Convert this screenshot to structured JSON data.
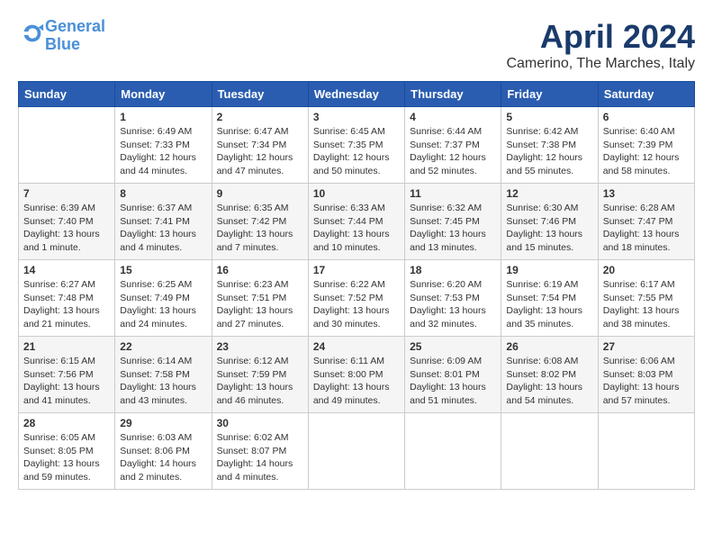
{
  "header": {
    "logo_line1": "General",
    "logo_line2": "Blue",
    "month": "April 2024",
    "location": "Camerino, The Marches, Italy"
  },
  "days_of_week": [
    "Sunday",
    "Monday",
    "Tuesday",
    "Wednesday",
    "Thursday",
    "Friday",
    "Saturday"
  ],
  "weeks": [
    [
      {
        "day": "",
        "info": ""
      },
      {
        "day": "1",
        "info": "Sunrise: 6:49 AM\nSunset: 7:33 PM\nDaylight: 12 hours\nand 44 minutes."
      },
      {
        "day": "2",
        "info": "Sunrise: 6:47 AM\nSunset: 7:34 PM\nDaylight: 12 hours\nand 47 minutes."
      },
      {
        "day": "3",
        "info": "Sunrise: 6:45 AM\nSunset: 7:35 PM\nDaylight: 12 hours\nand 50 minutes."
      },
      {
        "day": "4",
        "info": "Sunrise: 6:44 AM\nSunset: 7:37 PM\nDaylight: 12 hours\nand 52 minutes."
      },
      {
        "day": "5",
        "info": "Sunrise: 6:42 AM\nSunset: 7:38 PM\nDaylight: 12 hours\nand 55 minutes."
      },
      {
        "day": "6",
        "info": "Sunrise: 6:40 AM\nSunset: 7:39 PM\nDaylight: 12 hours\nand 58 minutes."
      }
    ],
    [
      {
        "day": "7",
        "info": "Sunrise: 6:39 AM\nSunset: 7:40 PM\nDaylight: 13 hours\nand 1 minute."
      },
      {
        "day": "8",
        "info": "Sunrise: 6:37 AM\nSunset: 7:41 PM\nDaylight: 13 hours\nand 4 minutes."
      },
      {
        "day": "9",
        "info": "Sunrise: 6:35 AM\nSunset: 7:42 PM\nDaylight: 13 hours\nand 7 minutes."
      },
      {
        "day": "10",
        "info": "Sunrise: 6:33 AM\nSunset: 7:44 PM\nDaylight: 13 hours\nand 10 minutes."
      },
      {
        "day": "11",
        "info": "Sunrise: 6:32 AM\nSunset: 7:45 PM\nDaylight: 13 hours\nand 13 minutes."
      },
      {
        "day": "12",
        "info": "Sunrise: 6:30 AM\nSunset: 7:46 PM\nDaylight: 13 hours\nand 15 minutes."
      },
      {
        "day": "13",
        "info": "Sunrise: 6:28 AM\nSunset: 7:47 PM\nDaylight: 13 hours\nand 18 minutes."
      }
    ],
    [
      {
        "day": "14",
        "info": "Sunrise: 6:27 AM\nSunset: 7:48 PM\nDaylight: 13 hours\nand 21 minutes."
      },
      {
        "day": "15",
        "info": "Sunrise: 6:25 AM\nSunset: 7:49 PM\nDaylight: 13 hours\nand 24 minutes."
      },
      {
        "day": "16",
        "info": "Sunrise: 6:23 AM\nSunset: 7:51 PM\nDaylight: 13 hours\nand 27 minutes."
      },
      {
        "day": "17",
        "info": "Sunrise: 6:22 AM\nSunset: 7:52 PM\nDaylight: 13 hours\nand 30 minutes."
      },
      {
        "day": "18",
        "info": "Sunrise: 6:20 AM\nSunset: 7:53 PM\nDaylight: 13 hours\nand 32 minutes."
      },
      {
        "day": "19",
        "info": "Sunrise: 6:19 AM\nSunset: 7:54 PM\nDaylight: 13 hours\nand 35 minutes."
      },
      {
        "day": "20",
        "info": "Sunrise: 6:17 AM\nSunset: 7:55 PM\nDaylight: 13 hours\nand 38 minutes."
      }
    ],
    [
      {
        "day": "21",
        "info": "Sunrise: 6:15 AM\nSunset: 7:56 PM\nDaylight: 13 hours\nand 41 minutes."
      },
      {
        "day": "22",
        "info": "Sunrise: 6:14 AM\nSunset: 7:58 PM\nDaylight: 13 hours\nand 43 minutes."
      },
      {
        "day": "23",
        "info": "Sunrise: 6:12 AM\nSunset: 7:59 PM\nDaylight: 13 hours\nand 46 minutes."
      },
      {
        "day": "24",
        "info": "Sunrise: 6:11 AM\nSunset: 8:00 PM\nDaylight: 13 hours\nand 49 minutes."
      },
      {
        "day": "25",
        "info": "Sunrise: 6:09 AM\nSunset: 8:01 PM\nDaylight: 13 hours\nand 51 minutes."
      },
      {
        "day": "26",
        "info": "Sunrise: 6:08 AM\nSunset: 8:02 PM\nDaylight: 13 hours\nand 54 minutes."
      },
      {
        "day": "27",
        "info": "Sunrise: 6:06 AM\nSunset: 8:03 PM\nDaylight: 13 hours\nand 57 minutes."
      }
    ],
    [
      {
        "day": "28",
        "info": "Sunrise: 6:05 AM\nSunset: 8:05 PM\nDaylight: 13 hours\nand 59 minutes."
      },
      {
        "day": "29",
        "info": "Sunrise: 6:03 AM\nSunset: 8:06 PM\nDaylight: 14 hours\nand 2 minutes."
      },
      {
        "day": "30",
        "info": "Sunrise: 6:02 AM\nSunset: 8:07 PM\nDaylight: 14 hours\nand 4 minutes."
      },
      {
        "day": "",
        "info": ""
      },
      {
        "day": "",
        "info": ""
      },
      {
        "day": "",
        "info": ""
      },
      {
        "day": "",
        "info": ""
      }
    ]
  ]
}
